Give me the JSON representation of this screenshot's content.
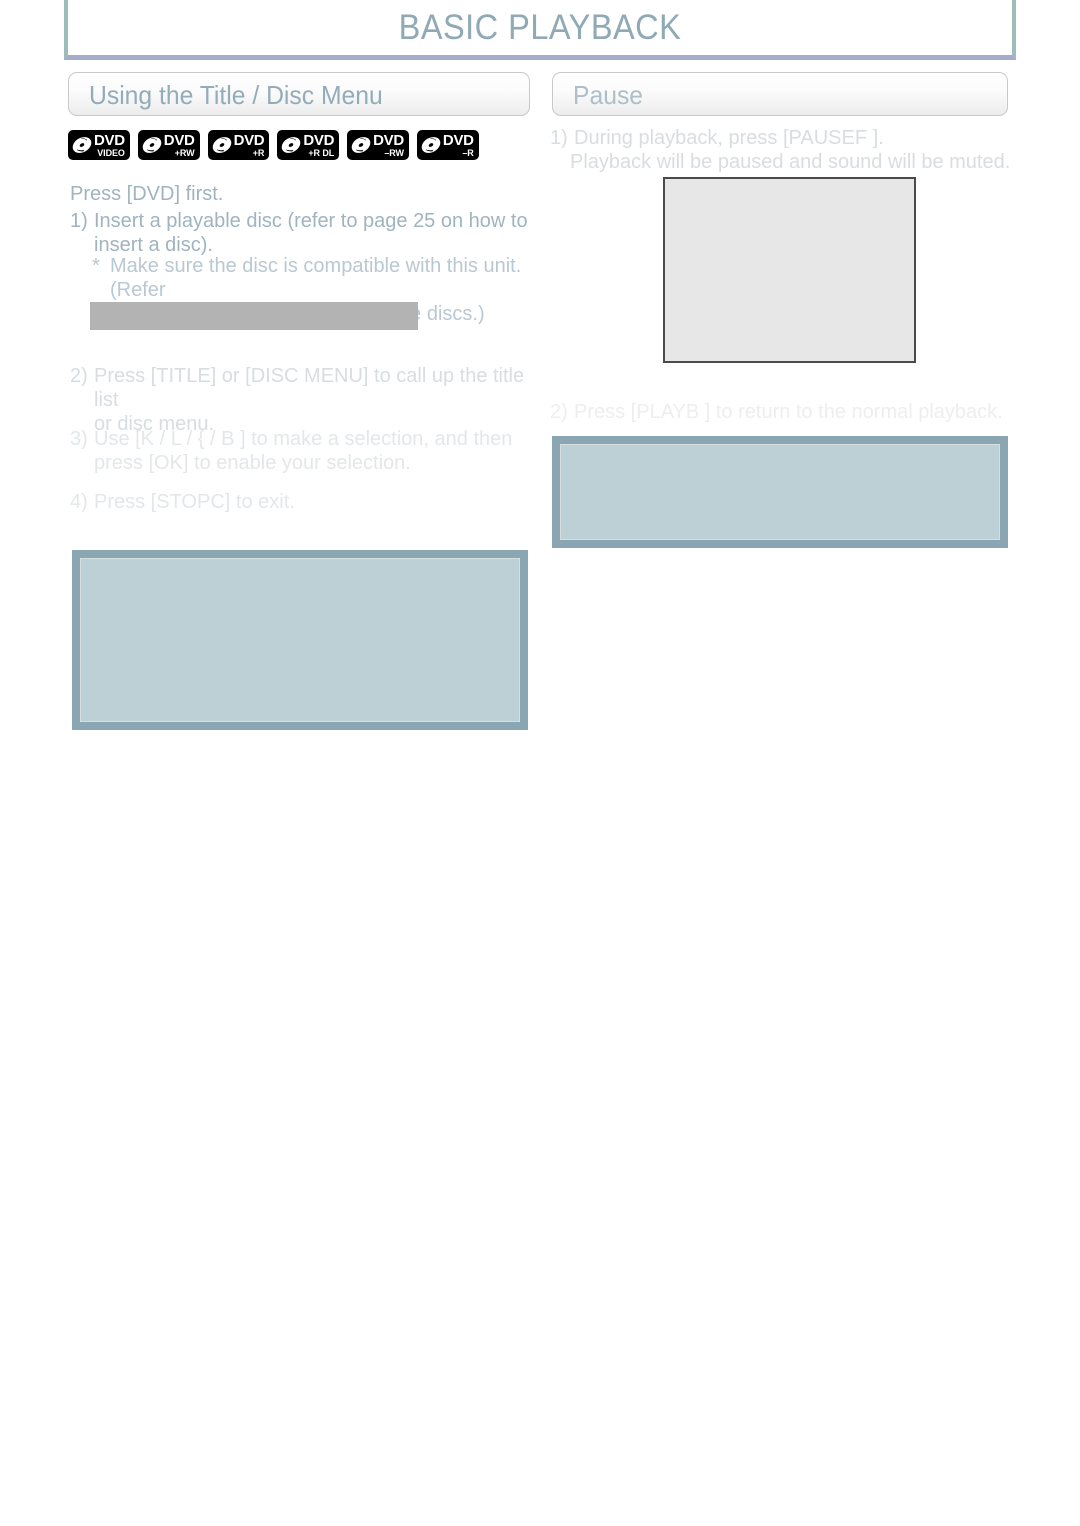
{
  "page": {
    "title": "BASIC PLAYBACK"
  },
  "sections": {
    "left": {
      "heading": "Using the Title / Disc Menu",
      "disc_logos": [
        {
          "main": "DVD",
          "sub": "VIDEO"
        },
        {
          "main": "DVD",
          "sub": "+RW"
        },
        {
          "main": "DVD",
          "sub": "+R"
        },
        {
          "main": "DVD",
          "sub": "+R DL"
        },
        {
          "main": "DVD",
          "sub": "–RW"
        },
        {
          "main": "DVD",
          "sub": "–R"
        }
      ],
      "intro": "Press [DVD] first.",
      "steps": [
        {
          "marker": "1)",
          "text": "Insert a playable disc (refer to page 25 on how to\ninsert a disc)."
        },
        {
          "marker": "2)",
          "text": "Press [TITLE] or [DISC MENU] to call up the title list\nor disc menu."
        },
        {
          "marker": "3)",
          "text": "Use [K / L / {   / B ] to make a selection, and then\npress [OK] to enable your selection."
        },
        {
          "marker": "4)",
          "text": "Press [STOPC] to exit."
        }
      ],
      "note": {
        "marker": "*",
        "text": "Make sure the disc is compatible with this unit. (Refer\nto page 58 for the list of compatible discs.)"
      }
    },
    "right": {
      "heading": "Pause",
      "steps": [
        {
          "marker": "1)",
          "text": "During playback, press [PAUSEF ].",
          "detail": "Playback will be paused and sound will be muted."
        },
        {
          "marker": "2)",
          "text": "Press [PLAYB ] to return to the normal playback."
        }
      ]
    }
  },
  "colors": {
    "title_text": "#8fa9b5",
    "heading_text": "#93acba",
    "body_text": "#9fb4c0",
    "banner_side_border": "#9dbcbc",
    "banner_bottom_border": "#a8aacb",
    "note_box_fill": "#bdd0d6",
    "note_box_border": "#8ba6b3",
    "photo_box_fill": "#e7e7e7",
    "photo_box_border": "#4a4a4a",
    "gray_bar": "#b3b3b3"
  }
}
